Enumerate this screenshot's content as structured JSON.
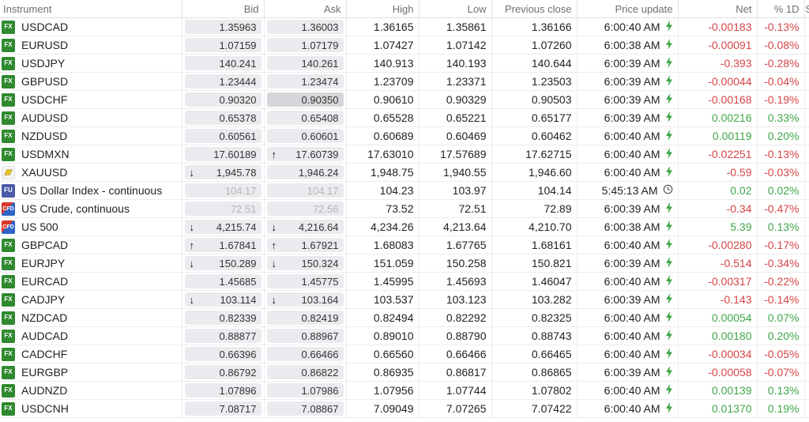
{
  "columns": {
    "instrument": "Instrument",
    "bid": "Bid",
    "ask": "Ask",
    "high": "High",
    "low": "Low",
    "prev": "Previous close",
    "update": "Price update",
    "net": "Net",
    "pct": "% 1D",
    "extra": "S"
  },
  "colors": {
    "negative": "#d64545",
    "positive": "#3fa648",
    "fx_badge": "#2f8a2f",
    "bolt": "#3fa648"
  },
  "rows": [
    {
      "badge": "FX",
      "name": "USDCAD",
      "bid": "1.35963",
      "ask": "1.36003",
      "high": "1.36165",
      "low": "1.35861",
      "prev": "1.36166",
      "update": "6:00:40 AM",
      "upd_icon": "bolt-icon",
      "net": "-0.00183",
      "pct": "-0.13%",
      "dir": "neg"
    },
    {
      "badge": "FX",
      "name": "EURUSD",
      "bid": "1.07159",
      "ask": "1.07179",
      "high": "1.07427",
      "low": "1.07142",
      "prev": "1.07260",
      "update": "6:00:38 AM",
      "upd_icon": "bolt-icon",
      "net": "-0.00091",
      "pct": "-0.08%",
      "dir": "neg"
    },
    {
      "badge": "FX",
      "name": "USDJPY",
      "bid": "140.241",
      "ask": "140.261",
      "high": "140.913",
      "low": "140.193",
      "prev": "140.644",
      "update": "6:00:39 AM",
      "upd_icon": "bolt-icon",
      "net": "-0.393",
      "pct": "-0.28%",
      "dir": "neg"
    },
    {
      "badge": "FX",
      "name": "GBPUSD",
      "bid": "1.23444",
      "ask": "1.23474",
      "high": "1.23709",
      "low": "1.23371",
      "prev": "1.23503",
      "update": "6:00:39 AM",
      "upd_icon": "bolt-icon",
      "net": "-0.00044",
      "pct": "-0.04%",
      "dir": "neg"
    },
    {
      "badge": "FX",
      "name": "USDCHF",
      "bid": "0.90320",
      "ask": "0.90350",
      "ask_dark": true,
      "high": "0.90610",
      "low": "0.90329",
      "prev": "0.90503",
      "update": "6:00:39 AM",
      "upd_icon": "bolt-icon",
      "net": "-0.00168",
      "pct": "-0.19%",
      "dir": "neg"
    },
    {
      "badge": "FX",
      "name": "AUDUSD",
      "bid": "0.65378",
      "ask": "0.65408",
      "high": "0.65528",
      "low": "0.65221",
      "prev": "0.65177",
      "update": "6:00:39 AM",
      "upd_icon": "bolt-icon",
      "net": "0.00216",
      "pct": "0.33%",
      "dir": "pos"
    },
    {
      "badge": "FX",
      "name": "NZDUSD",
      "bid": "0.60561",
      "ask": "0.60601",
      "high": "0.60689",
      "low": "0.60469",
      "prev": "0.60462",
      "update": "6:00:40 AM",
      "upd_icon": "bolt-icon",
      "net": "0.00119",
      "pct": "0.20%",
      "dir": "pos"
    },
    {
      "badge": "FX",
      "name": "USDMXN",
      "bid": "17.60189",
      "ask": "17.60739",
      "ask_arrow": "↑",
      "high": "17.63010",
      "low": "17.57689",
      "prev": "17.62715",
      "update": "6:00:40 AM",
      "upd_icon": "bolt-icon",
      "net": "-0.02251",
      "pct": "-0.13%",
      "dir": "neg"
    },
    {
      "badge": "GOLD",
      "name": "XAUUSD",
      "bid": "1,945.78",
      "bid_arrow": "↓",
      "ask": "1,946.24",
      "high": "1,948.75",
      "low": "1,940.55",
      "prev": "1,946.60",
      "update": "6:00:40 AM",
      "upd_icon": "bolt-icon",
      "net": "-0.59",
      "pct": "-0.03%",
      "dir": "neg"
    },
    {
      "badge": "FU",
      "name": "US Dollar Index - continuous",
      "bid": "104.17",
      "ask": "104.17",
      "stale": true,
      "high": "104.23",
      "low": "103.97",
      "prev": "104.14",
      "update": "5:45:13 AM",
      "upd_icon": "clock-icon",
      "net": "0.02",
      "pct": "0.02%",
      "dir": "pos"
    },
    {
      "badge": "CFD",
      "name": "US Crude, continuous",
      "bid": "72.51",
      "ask": "72.56",
      "stale": true,
      "high": "73.52",
      "low": "72.51",
      "prev": "72.89",
      "update": "6:00:39 AM",
      "upd_icon": "bolt-icon",
      "net": "-0.34",
      "pct": "-0.47%",
      "dir": "neg"
    },
    {
      "badge": "CFD",
      "name": "US 500",
      "bid": "4,215.74",
      "bid_arrow": "↓",
      "ask": "4,216.64",
      "ask_arrow": "↓",
      "high": "4,234.26",
      "low": "4,213.64",
      "prev": "4,210.70",
      "update": "6:00:38 AM",
      "upd_icon": "bolt-icon",
      "net": "5.39",
      "pct": "0.13%",
      "dir": "pos"
    },
    {
      "badge": "FX",
      "name": "GBPCAD",
      "bid": "1.67841",
      "bid_arrow": "↑",
      "ask": "1.67921",
      "ask_arrow": "↑",
      "high": "1.68083",
      "low": "1.67765",
      "prev": "1.68161",
      "update": "6:00:40 AM",
      "upd_icon": "bolt-icon",
      "net": "-0.00280",
      "pct": "-0.17%",
      "dir": "neg"
    },
    {
      "badge": "FX",
      "name": "EURJPY",
      "bid": "150.289",
      "bid_arrow": "↓",
      "ask": "150.324",
      "ask_arrow": "↓",
      "high": "151.059",
      "low": "150.258",
      "prev": "150.821",
      "update": "6:00:39 AM",
      "upd_icon": "bolt-icon",
      "net": "-0.514",
      "pct": "-0.34%",
      "dir": "neg"
    },
    {
      "badge": "FX",
      "name": "EURCAD",
      "bid": "1.45685",
      "ask": "1.45775",
      "high": "1.45995",
      "low": "1.45693",
      "prev": "1.46047",
      "update": "6:00:40 AM",
      "upd_icon": "bolt-icon",
      "net": "-0.00317",
      "pct": "-0.22%",
      "dir": "neg"
    },
    {
      "badge": "FX",
      "name": "CADJPY",
      "bid": "103.114",
      "bid_arrow": "↓",
      "ask": "103.164",
      "ask_arrow": "↓",
      "high": "103.537",
      "low": "103.123",
      "prev": "103.282",
      "update": "6:00:39 AM",
      "upd_icon": "bolt-icon",
      "net": "-0.143",
      "pct": "-0.14%",
      "dir": "neg"
    },
    {
      "badge": "FX",
      "name": "NZDCAD",
      "bid": "0.82339",
      "ask": "0.82419",
      "high": "0.82494",
      "low": "0.82292",
      "prev": "0.82325",
      "update": "6:00:40 AM",
      "upd_icon": "bolt-icon",
      "net": "0.00054",
      "pct": "0.07%",
      "dir": "pos"
    },
    {
      "badge": "FX",
      "name": "AUDCAD",
      "bid": "0.88877",
      "ask": "0.88967",
      "high": "0.89010",
      "low": "0.88790",
      "prev": "0.88743",
      "update": "6:00:40 AM",
      "upd_icon": "bolt-icon",
      "net": "0.00180",
      "pct": "0.20%",
      "dir": "pos"
    },
    {
      "badge": "FX",
      "name": "CADCHF",
      "bid": "0.66396",
      "ask": "0.66466",
      "high": "0.66560",
      "low": "0.66466",
      "prev": "0.66465",
      "update": "6:00:40 AM",
      "upd_icon": "bolt-icon",
      "net": "-0.00034",
      "pct": "-0.05%",
      "dir": "neg"
    },
    {
      "badge": "FX",
      "name": "EURGBP",
      "bid": "0.86792",
      "ask": "0.86822",
      "high": "0.86935",
      "low": "0.86817",
      "prev": "0.86865",
      "update": "6:00:39 AM",
      "upd_icon": "bolt-icon",
      "net": "-0.00058",
      "pct": "-0.07%",
      "dir": "neg"
    },
    {
      "badge": "FX",
      "name": "AUDNZD",
      "bid": "1.07896",
      "ask": "1.07986",
      "high": "1.07956",
      "low": "1.07744",
      "prev": "1.07802",
      "update": "6:00:40 AM",
      "upd_icon": "bolt-icon",
      "net": "0.00139",
      "pct": "0.13%",
      "dir": "pos"
    },
    {
      "badge": "FX",
      "name": "USDCNH",
      "bid": "7.08717",
      "ask": "7.08867",
      "high": "7.09049",
      "low": "7.07265",
      "prev": "7.07422",
      "update": "6:00:40 AM",
      "upd_icon": "bolt-icon",
      "net": "0.01370",
      "pct": "0.19%",
      "dir": "pos"
    }
  ]
}
